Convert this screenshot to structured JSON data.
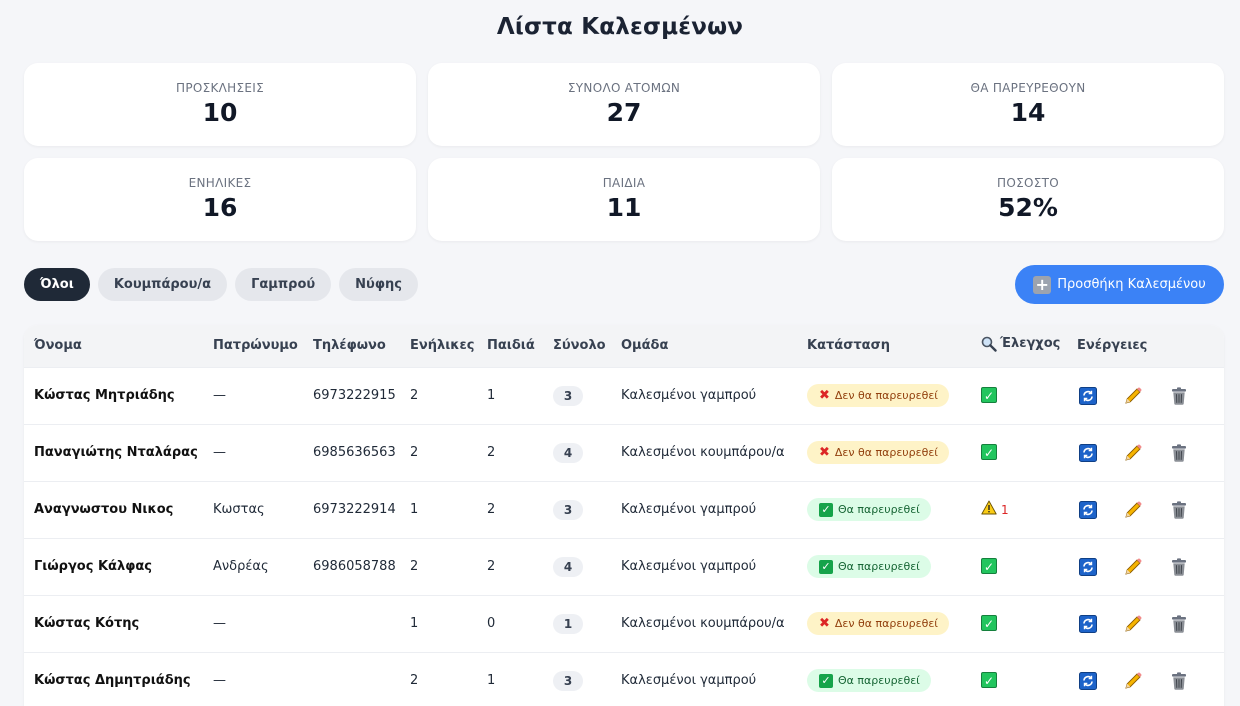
{
  "page": {
    "title": "Λίστα Καλεσμένων"
  },
  "stats": [
    {
      "label": "ΠΡΟΣΚΛΗΣΕΙΣ",
      "value": "10"
    },
    {
      "label": "ΣΥΝΟΛΟ ΑΤΟΜΩΝ",
      "value": "27"
    },
    {
      "label": "ΘΑ ΠΑΡΕΥΡΕΘΟΥΝ",
      "value": "14"
    },
    {
      "label": "ΕΝΗΛΙΚΕΣ",
      "value": "16"
    },
    {
      "label": "ΠΑΙΔΙΑ",
      "value": "11"
    },
    {
      "label": "ΠΟΣΟΣΤΟ",
      "value": "52%"
    }
  ],
  "filters": [
    {
      "label": "Όλοι",
      "active": true
    },
    {
      "label": "Κουμπάρου/α",
      "active": false
    },
    {
      "label": "Γαμπρού",
      "active": false
    },
    {
      "label": "Νύφης",
      "active": false
    }
  ],
  "add_button": {
    "label": "Προσθήκη Καλεσμένου",
    "icon": "plus-icon"
  },
  "table": {
    "headers": {
      "name": "Όνομα",
      "patronymic": "Πατρώνυμο",
      "phone": "Τηλέφωνο",
      "adults": "Ενήλικες",
      "children": "Παιδιά",
      "total": "Σύνολο",
      "group": "Ομάδα",
      "status": "Κατάσταση",
      "check": "Έλεγχος",
      "actions": "Ενέργειες"
    },
    "rows": [
      {
        "name": "Κώστας Μητριάδης",
        "patronymic": "—",
        "phone": "6973222915",
        "adults": "2",
        "children": "1",
        "total": "3",
        "group": "Καλεσμένοι γαμπρού",
        "status": "Δεν θα παρευρεθεί",
        "attending": false,
        "check": "ok",
        "warn_count": ""
      },
      {
        "name": "Παναγιώτης Νταλάρας",
        "patronymic": "—",
        "phone": "6985636563",
        "adults": "2",
        "children": "2",
        "total": "4",
        "group": "Καλεσμένοι κουμπάρου/α",
        "status": "Δεν θα παρευρεθεί",
        "attending": false,
        "check": "ok",
        "warn_count": ""
      },
      {
        "name": "Αναγνωστου Νικος",
        "patronymic": "Κωστας",
        "phone": "6973222914",
        "adults": "1",
        "children": "2",
        "total": "3",
        "group": "Καλεσμένοι γαμπρού",
        "status": "Θα παρευρεθεί",
        "attending": true,
        "check": "warn",
        "warn_count": "1"
      },
      {
        "name": "Γιώργος Κάλφας",
        "patronymic": "Ανδρέας",
        "phone": "6986058788",
        "adults": "2",
        "children": "2",
        "total": "4",
        "group": "Καλεσμένοι γαμπρού",
        "status": "Θα παρευρεθεί",
        "attending": true,
        "check": "ok",
        "warn_count": ""
      },
      {
        "name": "Κώστας Κότης",
        "patronymic": "—",
        "phone": "",
        "adults": "1",
        "children": "0",
        "total": "1",
        "group": "Καλεσμένοι κουμπάρου/α",
        "status": "Δεν θα παρευρεθεί",
        "attending": false,
        "check": "ok",
        "warn_count": ""
      },
      {
        "name": "Κώστας Δημητριάδης",
        "patronymic": "—",
        "phone": "",
        "adults": "2",
        "children": "1",
        "total": "3",
        "group": "Καλεσμένοι γαμπρού",
        "status": "Θα παρευρεθεί",
        "attending": true,
        "check": "ok",
        "warn_count": ""
      }
    ]
  },
  "colors": {
    "accent": "#3b82f6",
    "active_filter": "#1f2937",
    "not_attending_bg": "#fef3c7",
    "attending_bg": "#dcfce7"
  }
}
